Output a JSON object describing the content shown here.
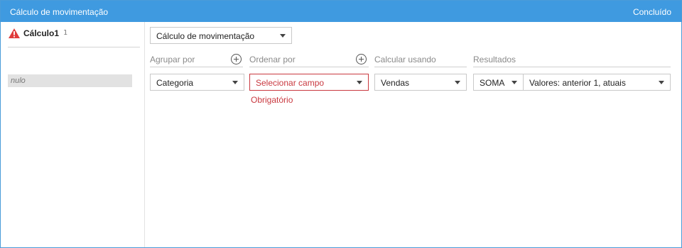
{
  "titlebar": {
    "title": "Cálculo de movimentação",
    "done_label": "Concluído"
  },
  "sidebar": {
    "calc_item": {
      "name": "Cálculo1",
      "count": "1",
      "status_icon": "warning-icon"
    },
    "null_value": "nulo"
  },
  "main": {
    "calc_type": "Cálculo de movimentação",
    "group_by": {
      "label": "Agrupar por",
      "value": "Categoria"
    },
    "order_by": {
      "label": "Ordenar por",
      "placeholder": "Selecionar campo",
      "error": "Obrigatório"
    },
    "compute_using": {
      "label": "Calcular usando",
      "value": "Vendas"
    },
    "results": {
      "label": "Resultados",
      "aggregation": "SOMA",
      "window": "Valores: anterior 1, atuais"
    }
  },
  "colors": {
    "titlebar": "#3f9ae0",
    "error": "#c9383f",
    "warning": "#e03b3b"
  }
}
